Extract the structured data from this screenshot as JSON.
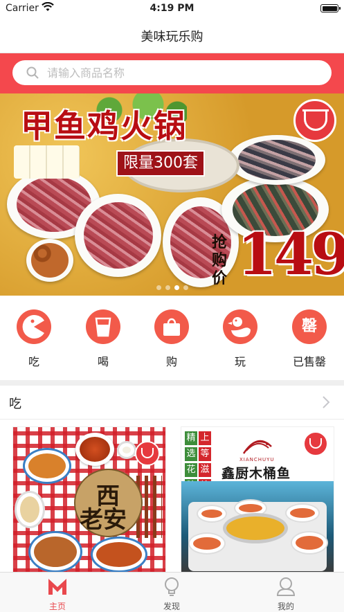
{
  "status_bar": {
    "carrier": "Carrier",
    "time": "4:19 PM"
  },
  "nav": {
    "title": "美味玩乐购"
  },
  "search": {
    "placeholder": "请输入商品名称",
    "value": ""
  },
  "banner": {
    "title": "甲鱼鸡火锅",
    "subtitle": "限量300套",
    "price_label": "抢购价",
    "price": "149",
    "dots": 4,
    "active_dot": 2
  },
  "categories": [
    {
      "label": "吃",
      "icon": "pacman-icon"
    },
    {
      "label": "喝",
      "icon": "cup-icon"
    },
    {
      "label": "购",
      "icon": "shopping-bag-icon"
    },
    {
      "label": "玩",
      "icon": "duck-icon"
    },
    {
      "label": "已售罄",
      "icon": "sold-out-icon",
      "icon_text": "罄"
    }
  ],
  "section": {
    "title": "吃"
  },
  "products": [
    {
      "badge_line1": "西",
      "badge_line2": "老安"
    },
    {
      "tags_red": [
        "上",
        "等"
      ],
      "tags_green": [
        "精",
        "选"
      ],
      "tags_row2_green": [
        "花",
        "胶"
      ],
      "tags_row2_red": [
        "滋",
        "补"
      ],
      "brand": "鑫厨木桶鱼",
      "brand_en": "XIANCHUYU"
    }
  ],
  "tab_bar": [
    {
      "label": "主页",
      "icon": "home-m-icon",
      "active": true
    },
    {
      "label": "发现",
      "icon": "lightbulb-icon",
      "active": false
    },
    {
      "label": "我的",
      "icon": "profile-icon",
      "active": false
    }
  ],
  "colors": {
    "accent": "#f4484d",
    "category_circle": "#f25a4a",
    "tab_active": "#e9484d"
  }
}
